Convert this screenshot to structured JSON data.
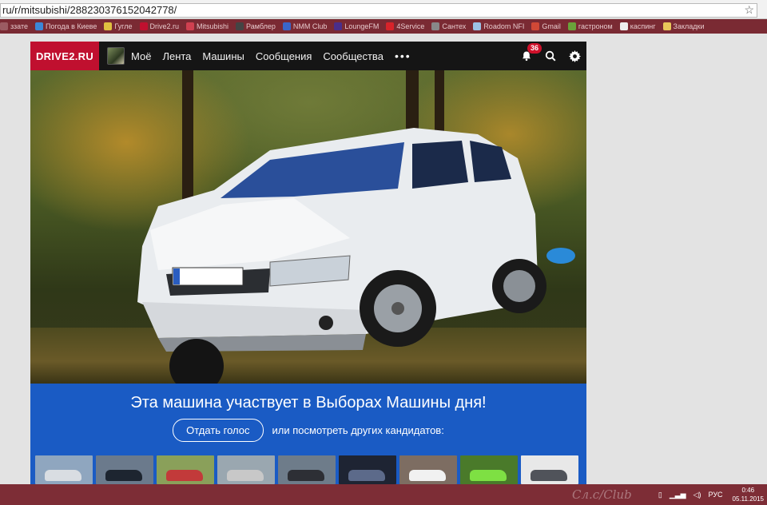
{
  "browser": {
    "url": "ru/r/mitsubishi/288230376152042778/",
    "bookmarks": [
      {
        "label": "ззате",
        "color": "#9b5b62"
      },
      {
        "label": "Погода в Киеве",
        "color": "#3b87d8"
      },
      {
        "label": "Гугле",
        "color": "#e0c040"
      },
      {
        "label": "Drive2.ru",
        "color": "#c0102f"
      },
      {
        "label": "Mitsubishi",
        "color": "#d04050"
      },
      {
        "label": "Рамблер",
        "color": "#444"
      },
      {
        "label": "NMM Club",
        "color": "#3a66c8"
      },
      {
        "label": "LoungeFM",
        "color": "#4a2e8a"
      },
      {
        "label": "4Service",
        "color": "#d8232a"
      },
      {
        "label": "Сантех",
        "color": "#888"
      },
      {
        "label": "Roadom NFI",
        "color": "#9cc2e6"
      },
      {
        "label": "Gmail",
        "color": "#d14836"
      },
      {
        "label": "гастроном",
        "color": "#6aa33a"
      },
      {
        "label": "каспинг",
        "color": "#eee"
      },
      {
        "label": "Закладки",
        "color": "#e8c85a"
      }
    ]
  },
  "site": {
    "logo": "DRIVE2.RU",
    "nav": [
      "Моё",
      "Лента",
      "Машины",
      "Сообщения",
      "Сообщества"
    ],
    "more": "•••",
    "notifications_count": "36"
  },
  "vote": {
    "title": "Эта машина участвует в Выборах Машины дня!",
    "button": "Отдать голос",
    "or_text": "или посмотреть других кандидатов:",
    "thumbs": [
      {
        "bg": "#8fa6bf",
        "car": "#d9dde2"
      },
      {
        "bg": "#6b7a8c",
        "car": "#1d2530"
      },
      {
        "bg": "#8aa05a",
        "car": "#c23a3a"
      },
      {
        "bg": "#9aa7b0",
        "car": "#c8c8c8"
      },
      {
        "bg": "#6e7c8a",
        "car": "#2d2f35"
      },
      {
        "bg": "#1e2433",
        "car": "#5c6a8a"
      },
      {
        "bg": "#7d6d62",
        "car": "#f1f1f1"
      },
      {
        "bg": "#4a7a2a",
        "car": "#7ee043"
      },
      {
        "bg": "#e8e8e8",
        "car": "#50535a"
      }
    ]
  },
  "taskbar": {
    "lang": "РУС",
    "time": "0:46",
    "date": "05.11.2015"
  }
}
